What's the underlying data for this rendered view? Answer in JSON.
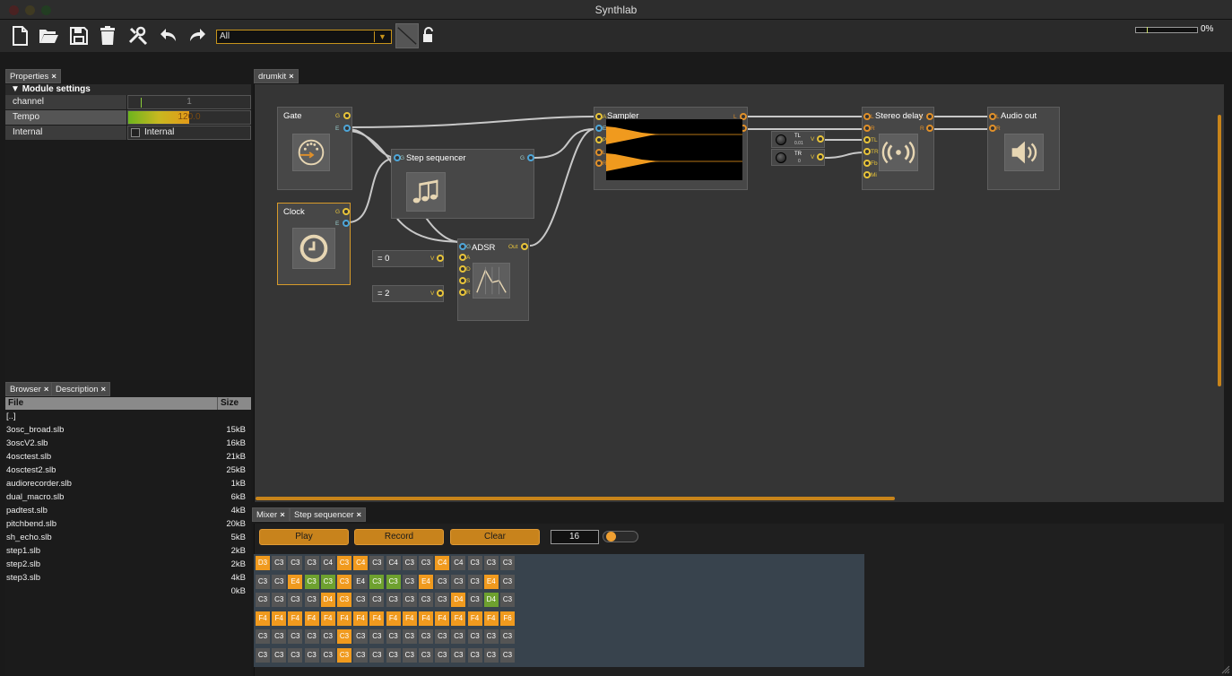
{
  "window": {
    "title": "Synthlab"
  },
  "toolbar": {
    "icons": [
      "new-file-icon",
      "open-folder-icon",
      "save-icon",
      "delete-icon",
      "settings-icon",
      "undo-icon",
      "redo-icon"
    ],
    "filter_value": "All",
    "cpu_percent": 0,
    "cpu_label": "0%"
  },
  "properties": {
    "tab_label": "Properties",
    "section": "Module settings",
    "rows": [
      {
        "key": "channel",
        "value": "1"
      },
      {
        "key": "Tempo",
        "value": "120.0"
      },
      {
        "key": "Internal",
        "value": "Internal"
      }
    ]
  },
  "browser": {
    "tab_browser": "Browser",
    "tab_description": "Description",
    "col_file": "File",
    "col_size": "Size",
    "files": [
      {
        "name": "[..]",
        "size": ""
      },
      {
        "name": "3osc_broad.slb",
        "size": "15kB"
      },
      {
        "name": "3oscV2.slb",
        "size": "16kB"
      },
      {
        "name": "4osctest.slb",
        "size": "21kB"
      },
      {
        "name": "4osctest2.slb",
        "size": "25kB"
      },
      {
        "name": "audiorecorder.slb",
        "size": "1kB"
      },
      {
        "name": "dual_macro.slb",
        "size": "6kB"
      },
      {
        "name": "padtest.slb",
        "size": "4kB"
      },
      {
        "name": "pitchbend.slb",
        "size": "20kB"
      },
      {
        "name": "sh_echo.slb",
        "size": "5kB"
      },
      {
        "name": "step1.slb",
        "size": "2kB"
      },
      {
        "name": "step2.slb",
        "size": "2kB"
      },
      {
        "name": "step3.slb",
        "size": "4kB"
      },
      {
        "name": "",
        "size": "0kB"
      }
    ]
  },
  "editor": {
    "tab_label": "drumkit",
    "modules": {
      "gate": {
        "title": "Gate",
        "ports": [
          "G",
          "E"
        ]
      },
      "clock": {
        "title": "Clock",
        "ports": [
          "G",
          "E"
        ]
      },
      "step_sequencer": {
        "title": "Step sequencer",
        "in": "G",
        "out": "G"
      },
      "adsr": {
        "title": "ADSR",
        "in": [
          "A",
          "D",
          "S",
          "R"
        ],
        "out": "Out",
        "gate_in": "G"
      },
      "sampler": {
        "title": "Sampler",
        "in": [
          "A",
          "E",
          "P",
          "L",
          "R"
        ],
        "out": [
          "L",
          "R"
        ]
      },
      "stereo_delay": {
        "title": "Stereo delay",
        "in": [
          "L",
          "R",
          "TL",
          "TR",
          "Fb",
          "Mi"
        ],
        "out": [
          "L",
          "R"
        ]
      },
      "audio_out": {
        "title": "Audio out",
        "in": [
          "L",
          "R"
        ]
      },
      "const_a": {
        "label": "= 0",
        "out": "V"
      },
      "const_b": {
        "label": "= 2",
        "out": "V"
      },
      "knob_tl": {
        "label": "TL",
        "value": "0.01",
        "out": "V"
      },
      "knob_tr": {
        "label": "TR",
        "value": "0",
        "out": "V"
      }
    }
  },
  "sequencer": {
    "tab_mixer": "Mixer",
    "tab_step": "Step sequencer",
    "play_label": "Play",
    "record_label": "Record",
    "clear_label": "Clear",
    "steps": "16",
    "slider_fraction": 0.1,
    "rows": [
      [
        "D3",
        "C3",
        "C3",
        "C3",
        "C4",
        "C3",
        "C4",
        "C3",
        "C4",
        "C3",
        "C3",
        "C4",
        "C4",
        "C3",
        "C3",
        "C3"
      ],
      [
        "C3",
        "C3",
        "E4",
        "C3",
        "C3",
        "C3",
        "E4",
        "C3",
        "C3",
        "C3",
        "E4",
        "C3",
        "C3",
        "C3",
        "E4",
        "C3"
      ],
      [
        "C3",
        "C3",
        "C3",
        "C3",
        "D4",
        "C3",
        "C3",
        "C3",
        "C3",
        "C3",
        "C3",
        "C3",
        "D4",
        "C3",
        "D4",
        "C3"
      ],
      [
        "F4",
        "F4",
        "F4",
        "F4",
        "F4",
        "F4",
        "F4",
        "F4",
        "F4",
        "F4",
        "F4",
        "F4",
        "F4",
        "F4",
        "F4",
        "F6"
      ],
      [
        "C3",
        "C3",
        "C3",
        "C3",
        "C3",
        "C3",
        "C3",
        "C3",
        "C3",
        "C3",
        "C3",
        "C3",
        "C3",
        "C3",
        "C3",
        "C3"
      ],
      [
        "C3",
        "C3",
        "C3",
        "C3",
        "C3",
        "C3",
        "C3",
        "C3",
        "C3",
        "C3",
        "C3",
        "C3",
        "C3",
        "C3",
        "C3",
        "C3"
      ]
    ],
    "states": [
      [
        "o",
        "n",
        "n",
        "n",
        "n",
        "o",
        "o",
        "n",
        "n",
        "n",
        "n",
        "o",
        "n",
        "n",
        "n",
        "n"
      ],
      [
        "n",
        "n",
        "o",
        "g",
        "g",
        "o",
        "n",
        "g",
        "g",
        "n",
        "o",
        "n",
        "n",
        "n",
        "o",
        "n"
      ],
      [
        "n",
        "n",
        "n",
        "n",
        "o",
        "o",
        "n",
        "n",
        "n",
        "n",
        "n",
        "n",
        "o",
        "n",
        "g",
        "n"
      ],
      [
        "o",
        "o",
        "o",
        "o",
        "o",
        "o",
        "o",
        "o",
        "o",
        "o",
        "o",
        "o",
        "o",
        "o",
        "o",
        "o"
      ],
      [
        "n",
        "n",
        "n",
        "n",
        "n",
        "o",
        "n",
        "n",
        "n",
        "n",
        "n",
        "n",
        "n",
        "n",
        "n",
        "n"
      ],
      [
        "n",
        "n",
        "n",
        "n",
        "n",
        "o",
        "n",
        "n",
        "n",
        "n",
        "n",
        "n",
        "n",
        "n",
        "n",
        "n"
      ]
    ],
    "colors": {
      "active": "#f09a1e",
      "alt": "#6ea12f",
      "off": "#555555"
    }
  }
}
